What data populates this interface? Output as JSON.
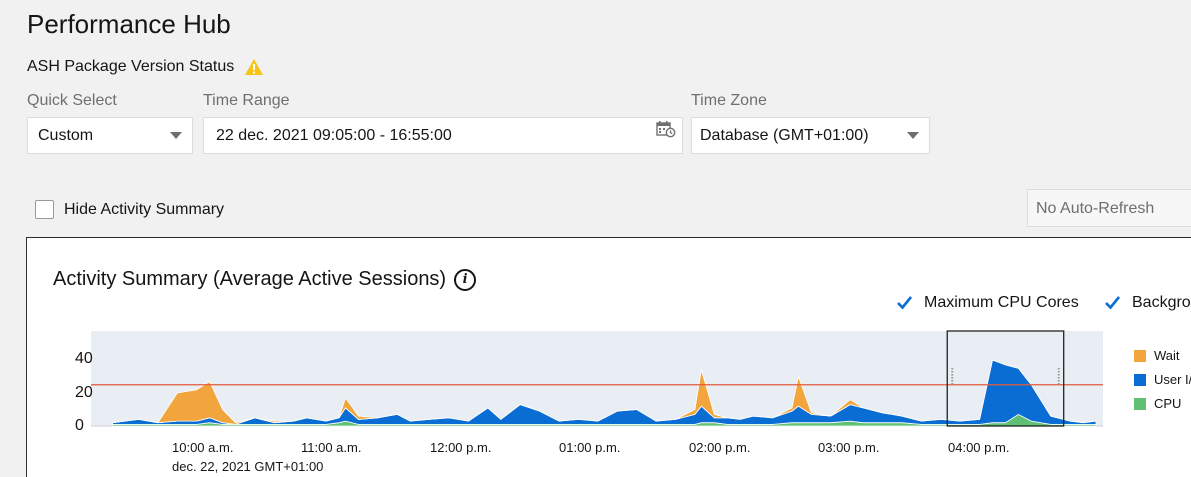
{
  "page": {
    "title": "Performance Hub",
    "ash_status_label": "ASH Package Version Status",
    "ash_status_icon": "warning-icon"
  },
  "filters": {
    "quick_select": {
      "label": "Quick Select",
      "value": "Custom"
    },
    "time_range": {
      "label": "Time Range",
      "value": "22 dec. 2021 09:05:00 - 16:55:00",
      "icon": "calendar-clock-icon"
    },
    "time_zone": {
      "label": "Time Zone",
      "value": "Database (GMT+01:00)"
    }
  },
  "hide_summary": {
    "label": "Hide Activity Summary",
    "checked": false
  },
  "auto_refresh": {
    "value": "No Auto-Refresh"
  },
  "activity": {
    "title": "Activity Summary (Average Active Sessions)",
    "max_cpu_label": "Maximum CPU Cores",
    "max_cpu_checked": true,
    "background_label": "Backgro",
    "background_checked": true,
    "date_caption": "dec. 22, 2021 GMT+01:00"
  },
  "colors": {
    "wait": "#f2a53c",
    "user_io": "#0a6dd3",
    "cpu": "#5fbf72",
    "max_cpu_line": "#e45a3b",
    "plot_bg": "#e8eef4"
  },
  "chart_data": {
    "type": "area",
    "stacked": true,
    "title": "Activity Summary (Average Active Sessions)",
    "x_ticks": [
      "10:00 a.m.",
      "11:00 a.m.",
      "12:00 p.m.",
      "01:00 p.m.",
      "02:00 p.m.",
      "03:00 p.m.",
      "04:00 p.m."
    ],
    "x_hours": [
      9.25,
      9.45,
      9.6,
      9.75,
      9.9,
      10.0,
      10.1,
      10.2,
      10.35,
      10.5,
      10.65,
      10.75,
      10.9,
      11.0,
      11.05,
      11.15,
      11.3,
      11.45,
      11.55,
      11.7,
      11.85,
      12.0,
      12.15,
      12.25,
      12.4,
      12.55,
      12.7,
      12.85,
      13.0,
      13.15,
      13.3,
      13.45,
      13.6,
      13.75,
      13.8,
      13.9,
      14.0,
      14.1,
      14.2,
      14.35,
      14.5,
      14.55,
      14.65,
      14.8,
      14.95,
      15.05,
      15.2,
      15.35,
      15.5,
      15.65,
      15.8,
      15.95,
      16.05,
      16.15,
      16.25,
      16.35,
      16.5,
      16.65,
      16.75,
      16.85
    ],
    "y_ticks": [
      0,
      20,
      40
    ],
    "ylim": [
      0,
      57
    ],
    "max_cpu_cores": 25,
    "selection_window": {
      "from": "15.7",
      "to": "16.6"
    },
    "series": [
      {
        "name": "Wait",
        "values": [
          0,
          0,
          0,
          17,
          19,
          22,
          8,
          1,
          0,
          1,
          0,
          0,
          0,
          0,
          6,
          2,
          0,
          0,
          0,
          0,
          0,
          0,
          0,
          0,
          0,
          0,
          0,
          0,
          0,
          0,
          0,
          0,
          0,
          3,
          22,
          2,
          0,
          0,
          0,
          0,
          2,
          18,
          1,
          0,
          3,
          0,
          0,
          0,
          0,
          0,
          0,
          0,
          0,
          0,
          0,
          0,
          0,
          0,
          0,
          0
        ]
      },
      {
        "name": "User I/O",
        "values": [
          1,
          3,
          1,
          2,
          2,
          3,
          1,
          0,
          4,
          1,
          2,
          4,
          2,
          3,
          8,
          3,
          4,
          6,
          2,
          3,
          4,
          2,
          10,
          3,
          12,
          8,
          2,
          3,
          2,
          8,
          9,
          2,
          3,
          6,
          10,
          3,
          4,
          3,
          5,
          4,
          7,
          10,
          5,
          4,
          10,
          9,
          6,
          4,
          2,
          3,
          2,
          3,
          38,
          35,
          28,
          22,
          5,
          2,
          1,
          2
        ]
      },
      {
        "name": "CPU",
        "values": [
          1,
          1,
          1,
          1,
          1,
          2,
          1,
          1,
          1,
          1,
          1,
          1,
          1,
          2,
          3,
          1,
          1,
          1,
          1,
          1,
          1,
          1,
          1,
          1,
          1,
          1,
          1,
          1,
          1,
          1,
          1,
          1,
          1,
          1,
          2,
          2,
          1,
          1,
          1,
          1,
          2,
          2,
          2,
          2,
          3,
          2,
          2,
          2,
          1,
          1,
          1,
          1,
          2,
          2,
          7,
          3,
          1,
          1,
          1,
          1
        ]
      }
    ]
  }
}
